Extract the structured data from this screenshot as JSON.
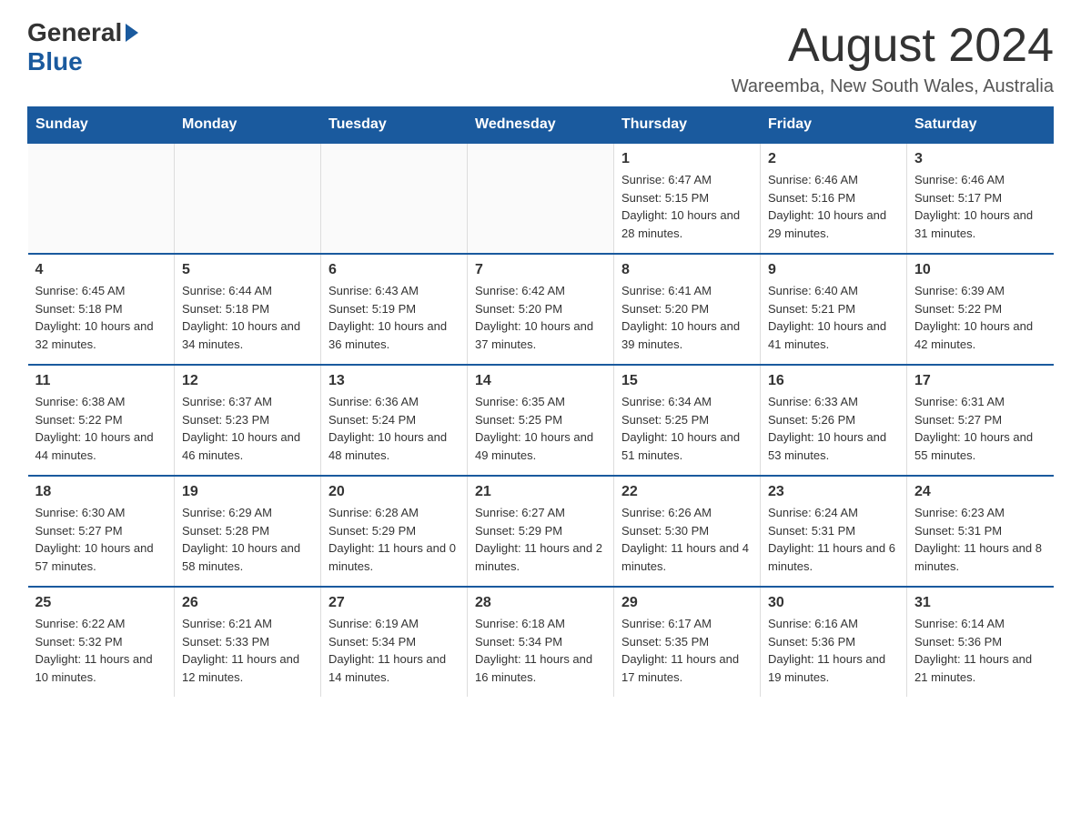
{
  "logo": {
    "general": "General",
    "blue": "Blue"
  },
  "header": {
    "month": "August 2024",
    "location": "Wareemba, New South Wales, Australia"
  },
  "days_of_week": [
    "Sunday",
    "Monday",
    "Tuesday",
    "Wednesday",
    "Thursday",
    "Friday",
    "Saturday"
  ],
  "weeks": [
    [
      {
        "day": "",
        "info": ""
      },
      {
        "day": "",
        "info": ""
      },
      {
        "day": "",
        "info": ""
      },
      {
        "day": "",
        "info": ""
      },
      {
        "day": "1",
        "info": "Sunrise: 6:47 AM\nSunset: 5:15 PM\nDaylight: 10 hours and 28 minutes."
      },
      {
        "day": "2",
        "info": "Sunrise: 6:46 AM\nSunset: 5:16 PM\nDaylight: 10 hours and 29 minutes."
      },
      {
        "day": "3",
        "info": "Sunrise: 6:46 AM\nSunset: 5:17 PM\nDaylight: 10 hours and 31 minutes."
      }
    ],
    [
      {
        "day": "4",
        "info": "Sunrise: 6:45 AM\nSunset: 5:18 PM\nDaylight: 10 hours and 32 minutes."
      },
      {
        "day": "5",
        "info": "Sunrise: 6:44 AM\nSunset: 5:18 PM\nDaylight: 10 hours and 34 minutes."
      },
      {
        "day": "6",
        "info": "Sunrise: 6:43 AM\nSunset: 5:19 PM\nDaylight: 10 hours and 36 minutes."
      },
      {
        "day": "7",
        "info": "Sunrise: 6:42 AM\nSunset: 5:20 PM\nDaylight: 10 hours and 37 minutes."
      },
      {
        "day": "8",
        "info": "Sunrise: 6:41 AM\nSunset: 5:20 PM\nDaylight: 10 hours and 39 minutes."
      },
      {
        "day": "9",
        "info": "Sunrise: 6:40 AM\nSunset: 5:21 PM\nDaylight: 10 hours and 41 minutes."
      },
      {
        "day": "10",
        "info": "Sunrise: 6:39 AM\nSunset: 5:22 PM\nDaylight: 10 hours and 42 minutes."
      }
    ],
    [
      {
        "day": "11",
        "info": "Sunrise: 6:38 AM\nSunset: 5:22 PM\nDaylight: 10 hours and 44 minutes."
      },
      {
        "day": "12",
        "info": "Sunrise: 6:37 AM\nSunset: 5:23 PM\nDaylight: 10 hours and 46 minutes."
      },
      {
        "day": "13",
        "info": "Sunrise: 6:36 AM\nSunset: 5:24 PM\nDaylight: 10 hours and 48 minutes."
      },
      {
        "day": "14",
        "info": "Sunrise: 6:35 AM\nSunset: 5:25 PM\nDaylight: 10 hours and 49 minutes."
      },
      {
        "day": "15",
        "info": "Sunrise: 6:34 AM\nSunset: 5:25 PM\nDaylight: 10 hours and 51 minutes."
      },
      {
        "day": "16",
        "info": "Sunrise: 6:33 AM\nSunset: 5:26 PM\nDaylight: 10 hours and 53 minutes."
      },
      {
        "day": "17",
        "info": "Sunrise: 6:31 AM\nSunset: 5:27 PM\nDaylight: 10 hours and 55 minutes."
      }
    ],
    [
      {
        "day": "18",
        "info": "Sunrise: 6:30 AM\nSunset: 5:27 PM\nDaylight: 10 hours and 57 minutes."
      },
      {
        "day": "19",
        "info": "Sunrise: 6:29 AM\nSunset: 5:28 PM\nDaylight: 10 hours and 58 minutes."
      },
      {
        "day": "20",
        "info": "Sunrise: 6:28 AM\nSunset: 5:29 PM\nDaylight: 11 hours and 0 minutes."
      },
      {
        "day": "21",
        "info": "Sunrise: 6:27 AM\nSunset: 5:29 PM\nDaylight: 11 hours and 2 minutes."
      },
      {
        "day": "22",
        "info": "Sunrise: 6:26 AM\nSunset: 5:30 PM\nDaylight: 11 hours and 4 minutes."
      },
      {
        "day": "23",
        "info": "Sunrise: 6:24 AM\nSunset: 5:31 PM\nDaylight: 11 hours and 6 minutes."
      },
      {
        "day": "24",
        "info": "Sunrise: 6:23 AM\nSunset: 5:31 PM\nDaylight: 11 hours and 8 minutes."
      }
    ],
    [
      {
        "day": "25",
        "info": "Sunrise: 6:22 AM\nSunset: 5:32 PM\nDaylight: 11 hours and 10 minutes."
      },
      {
        "day": "26",
        "info": "Sunrise: 6:21 AM\nSunset: 5:33 PM\nDaylight: 11 hours and 12 minutes."
      },
      {
        "day": "27",
        "info": "Sunrise: 6:19 AM\nSunset: 5:34 PM\nDaylight: 11 hours and 14 minutes."
      },
      {
        "day": "28",
        "info": "Sunrise: 6:18 AM\nSunset: 5:34 PM\nDaylight: 11 hours and 16 minutes."
      },
      {
        "day": "29",
        "info": "Sunrise: 6:17 AM\nSunset: 5:35 PM\nDaylight: 11 hours and 17 minutes."
      },
      {
        "day": "30",
        "info": "Sunrise: 6:16 AM\nSunset: 5:36 PM\nDaylight: 11 hours and 19 minutes."
      },
      {
        "day": "31",
        "info": "Sunrise: 6:14 AM\nSunset: 5:36 PM\nDaylight: 11 hours and 21 minutes."
      }
    ]
  ]
}
